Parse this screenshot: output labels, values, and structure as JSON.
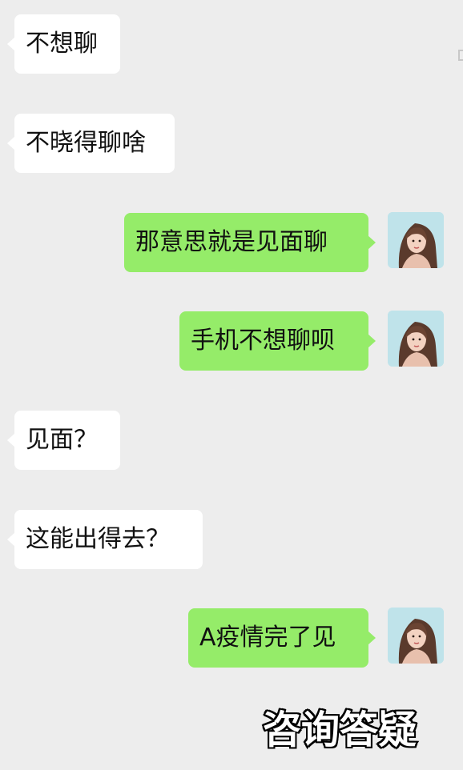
{
  "messages": [
    {
      "side": "in",
      "text": "不想聊"
    },
    {
      "side": "in",
      "text": "不晓得聊啥"
    },
    {
      "side": "out",
      "text": "那意思就是见面聊"
    },
    {
      "side": "out",
      "text": "手机不想聊呗"
    },
    {
      "side": "in",
      "text": "见面？"
    },
    {
      "side": "in",
      "text": "这能出得去？"
    },
    {
      "side": "out",
      "text": "A疫情完了见"
    }
  ],
  "caption": "咨询答疑",
  "icons": {
    "avatar": "avatar-woman-icon"
  },
  "colors": {
    "background": "#ededed",
    "incoming_bubble": "#ffffff",
    "outgoing_bubble": "#95ec69",
    "text": "#111111"
  }
}
